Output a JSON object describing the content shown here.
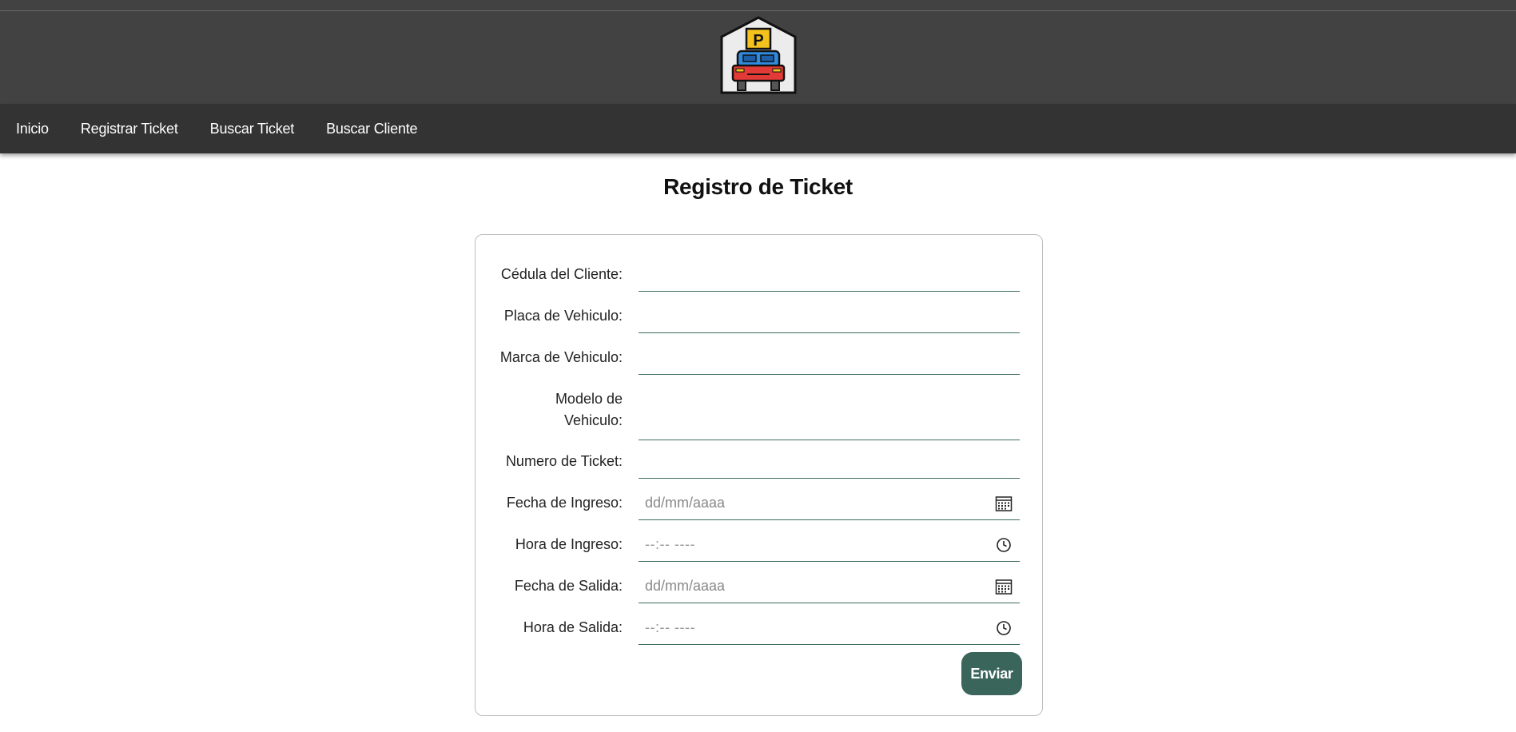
{
  "nav": {
    "items": [
      {
        "label": "Inicio"
      },
      {
        "label": "Registrar Ticket"
      },
      {
        "label": "Buscar Ticket"
      },
      {
        "label": "Buscar Cliente"
      }
    ]
  },
  "header": {
    "logo_icon": "parking-garage-car-logo",
    "logo_letter": "P"
  },
  "form": {
    "title": "Registro de Ticket",
    "fields": [
      {
        "label": "Cédula del Cliente:",
        "value": "",
        "type": "text"
      },
      {
        "label": "Placa de Vehiculo:",
        "value": "",
        "type": "text"
      },
      {
        "label": "Marca de Vehiculo:",
        "value": "",
        "type": "text"
      },
      {
        "label_line1": "Modelo de",
        "label_line2": "Vehiculo:",
        "value": "",
        "type": "text"
      },
      {
        "label": "Numero de Ticket:",
        "value": "",
        "type": "text"
      },
      {
        "label": "Fecha de Ingreso:",
        "placeholder": "dd/mm/aaaa",
        "type": "date",
        "icon": "calendar-icon"
      },
      {
        "label": "Hora de Ingreso:",
        "placeholder": "--:-- ----",
        "type": "time",
        "icon": "clock-icon"
      },
      {
        "label": "Fecha de Salida:",
        "placeholder": "dd/mm/aaaa",
        "type": "date",
        "icon": "calendar-icon"
      },
      {
        "label": "Hora de Salida:",
        "placeholder": "--:-- ----",
        "type": "time",
        "icon": "clock-icon"
      }
    ],
    "submit_label": "Enviar"
  },
  "colors": {
    "header_bg": "#424242",
    "nav_bg": "#333333",
    "accent": "#3a655a",
    "field_underline": "#3e6b60"
  }
}
